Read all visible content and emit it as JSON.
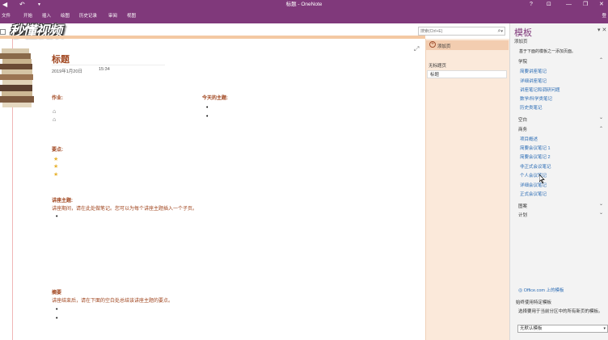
{
  "window": {
    "title": "标题 - OneNote",
    "help": "?",
    "ribbon_display": "⊡",
    "minimize": "—",
    "restore": "❐",
    "close": "✕"
  },
  "quick_access": {
    "back": "◀",
    "undo": "↶",
    "customize": "▾"
  },
  "ribbon": {
    "tabs": [
      "文件",
      "开始",
      "插入",
      "绘图",
      "历史记录",
      "审阅",
      "视图"
    ],
    "signin": "登"
  },
  "search": {
    "placeholder": "搜索(Ctrl+E)",
    "icon": "⌕",
    "dropdown": "▾"
  },
  "watermark": "秒懂视频",
  "page": {
    "title": "标题",
    "date": "2019年1月20日",
    "time": "15:34",
    "homework_head": "作业:",
    "today_head": "今天的主题:",
    "points_head": "要点:",
    "lecture_head": "讲座主题:",
    "lecture_text": "讲座期间，请在此处做笔记。您可以为每个讲座主题插入一个子页。",
    "summary_head": "摘要",
    "summary_text": "讲座结束后，请在下面的空白处总结该讲座主题的要点。",
    "bullet": "•",
    "house_icon": "⌂",
    "star_icon": "★",
    "expand_icon": "⤢"
  },
  "pagelist": {
    "add_page": "添加页",
    "add_icon": "+",
    "items": [
      "无标题页",
      "标题"
    ]
  },
  "templates": {
    "title": "模板",
    "close": "✕",
    "chevron_down": "▾",
    "add_page": "添加页",
    "desc": "基于下面的模板之一添加页面。",
    "categories": {
      "academic": "学院",
      "blank": "空白",
      "business": "商务",
      "decorative": "图案",
      "planners": "计划"
    },
    "chev_up": "⌃",
    "chev_down": "⌄",
    "academic_items": [
      "简要讲座笔记",
      "详细讲座笔记",
      "讲座笔记和调研问题",
      "数学/科学类笔记",
      "历史类笔记"
    ],
    "business_items": [
      "项目概述",
      "简要会议笔记 1",
      "简要会议笔记 2",
      "非正式会议笔记",
      "个人会议笔记",
      "详细会议笔记",
      "正式会议笔记"
    ],
    "office_link": "Office.com 上的模板",
    "office_icon": "◎",
    "default_head": "始终使用特定模板",
    "default_desc": "选择要用于当前分区中的所有新页的模板。",
    "default_select": "无默认模板",
    "select_arrow": "▾"
  }
}
